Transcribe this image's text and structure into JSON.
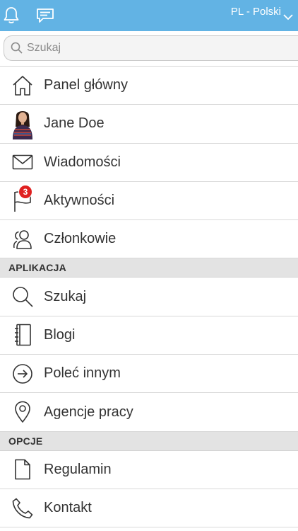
{
  "topbar": {
    "language_label": "PL - Polski",
    "bg_color": "#62b3e4",
    "icons": [
      "bell-icon",
      "chat-icon",
      "chevron-down-icon"
    ]
  },
  "search": {
    "placeholder": "Szukaj",
    "value": ""
  },
  "menu": {
    "items": [
      {
        "label": "Panel główny",
        "icon": "home-icon"
      },
      {
        "label": "Jane Doe",
        "icon": "avatar"
      },
      {
        "label": "Wiadomości",
        "icon": "envelope-icon"
      },
      {
        "label": "Aktywności",
        "icon": "flag-icon",
        "badge": "3"
      },
      {
        "label": "Członkowie",
        "icon": "members-icon"
      }
    ]
  },
  "sections": {
    "apps": {
      "title": "APLIKACJA",
      "items": [
        {
          "label": "Szukaj",
          "icon": "search-icon"
        },
        {
          "label": "Blogi",
          "icon": "notebook-icon"
        },
        {
          "label": "Poleć innym",
          "icon": "arrow-circle-icon"
        },
        {
          "label": "Agencje pracy",
          "icon": "location-pin-icon"
        }
      ]
    },
    "options": {
      "title": "OPCJE",
      "items": [
        {
          "label": "Regulamin",
          "icon": "document-icon"
        },
        {
          "label": "Kontakt",
          "icon": "phone-icon"
        }
      ]
    }
  },
  "colors": {
    "badge": "#e02020",
    "section_bg": "#e3e3e3",
    "text": "#333333"
  }
}
